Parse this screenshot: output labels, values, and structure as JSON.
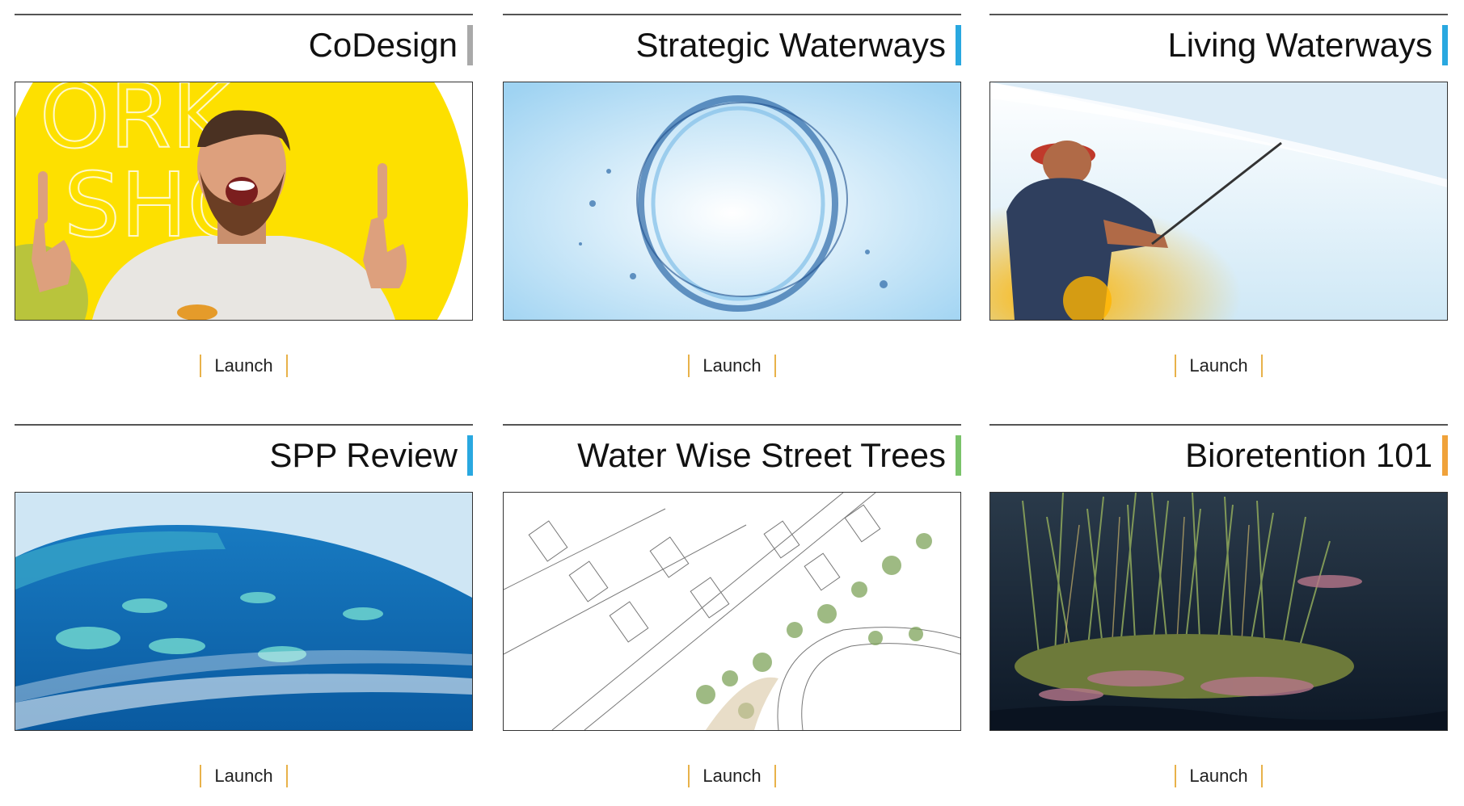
{
  "cards": [
    {
      "title": "CoDesign",
      "accent": "#a9a9a9",
      "image": "person-pointing-up",
      "launch_label": "Launch"
    },
    {
      "title": "Strategic Waterways",
      "accent": "#29a8e0",
      "image": "water-ring-splash",
      "launch_label": "Launch"
    },
    {
      "title": "Living Waterways",
      "accent": "#29a8e0",
      "image": "fisherman-sunset",
      "launch_label": "Launch"
    },
    {
      "title": "SPP Review",
      "accent": "#29a8e0",
      "image": "reef-aerial",
      "launch_label": "Launch"
    },
    {
      "title": "Water Wise Street Trees",
      "accent": "#7ac36a",
      "image": "street-sketch",
      "launch_label": "Launch"
    },
    {
      "title": "Bioretention 101",
      "accent": "#f0a23a",
      "image": "wetland-reeds",
      "launch_label": "Launch"
    }
  ],
  "colors": {
    "launch_border": "#e8b24a",
    "rule": "#555555"
  }
}
